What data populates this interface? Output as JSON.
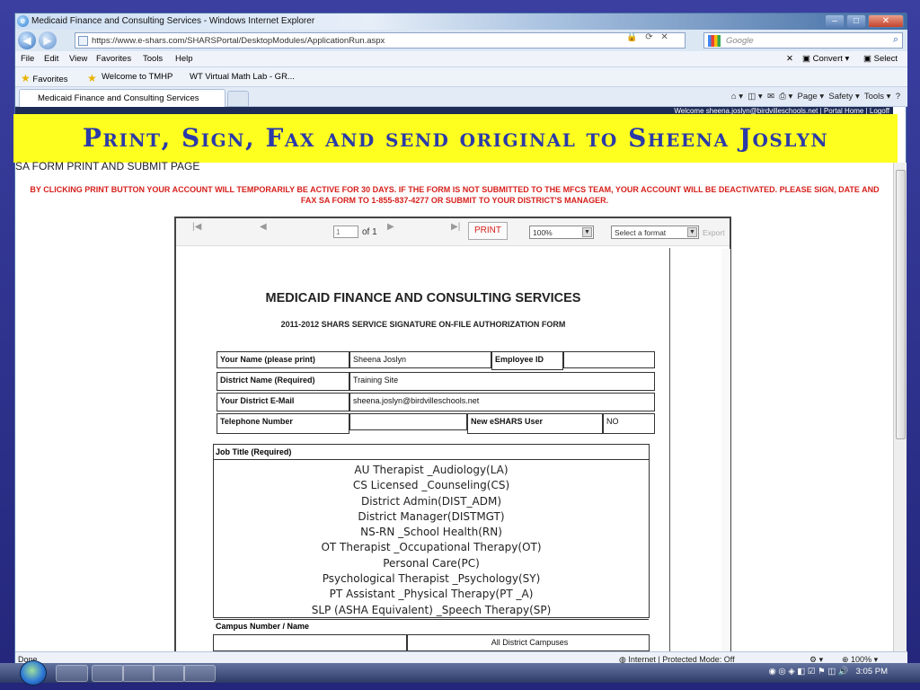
{
  "window": {
    "title": "Medicaid Finance and Consulting Services - Windows Internet Explorer"
  },
  "browser": {
    "url": "https://www.e-shars.com/SHARSPortal/DesktopModules/ApplicationRun.aspx",
    "search_placeholder": "Google",
    "menu": [
      "File",
      "Edit",
      "View",
      "Favorites",
      "Tools",
      "Help"
    ],
    "convert_label": "Convert",
    "select_label": "Select",
    "favorites_label": "Favorites",
    "favorite_links": [
      "Welcome to TMHP",
      "WT Virtual Math Lab - GR..."
    ],
    "tab_title": "Medicaid Finance and Consulting Services",
    "command_bar": [
      "Page",
      "Safety",
      "Tools"
    ],
    "status_left": "Done",
    "status_zone": "Internet | Protected Mode: Off",
    "zoom": "100%"
  },
  "page": {
    "portal_links": "Welcome sheena.joslyn@birdvilleschools.net | Portal Home | Logoff",
    "banner": "Print, Sign, Fax and send original to Sheena Joslyn",
    "title": "SA FORM PRINT AND SUBMIT PAGE",
    "warning": "BY CLICKING PRINT BUTTON YOUR ACCOUNT WILL TEMPORARILY BE ACTIVE FOR 30 DAYS. IF THE FORM IS NOT SUBMITTED TO THE MFCS TEAM, YOUR ACCOUNT WILL BE DEACTIVATED. PLEASE SIGN, DATE AND FAX SA FORM TO 1-855-837-4277 OR SUBMIT TO YOUR DISTRICT'S MANAGER."
  },
  "viewer": {
    "page_number": "1",
    "page_of": "of 1",
    "print_label": "PRINT",
    "zoom_value": "100%",
    "format_placeholder": "Select a format",
    "export_label": "Export"
  },
  "form": {
    "heading": "MEDICAID FINANCE AND CONSULTING SERVICES",
    "subheading": "2011-2012 SHARS SERVICE SIGNATURE ON-FILE AUTHORIZATION FORM",
    "name_label": "Your Name (please print)",
    "name_value": "Sheena Joslyn",
    "employee_id_label": "Employee ID",
    "employee_id_value": "",
    "district_label": "District Name (Required)",
    "district_value": "Training Site",
    "email_label": "Your District E-Mail",
    "email_value": "sheena.joslyn@birdvilleschools.net",
    "phone_label": "Telephone Number",
    "phone_value": "",
    "new_user_label": "New eSHARS User",
    "new_user_value": "NO",
    "job_title_label": "Job Title (Required)",
    "job_titles": [
      "AU Therapist _Audiology(LA)",
      "CS Licensed _Counseling(CS)",
      "District Admin(DIST_ADM)",
      "District Manager(DISTMGT)",
      "NS-RN _School Health(RN)",
      "OT Therapist _Occupational Therapy(OT)",
      "Personal Care(PC)",
      "Psychological Therapist _Psychology(SY)",
      "PT Assistant _Physical Therapy(PT _A)",
      "SLP (ASHA Equivalent) _Speech Therapy(SP)"
    ],
    "campus_label": "Campus Number / Name",
    "campus_value": "All District Campuses"
  },
  "taskbar": {
    "time": "3:05 PM"
  }
}
